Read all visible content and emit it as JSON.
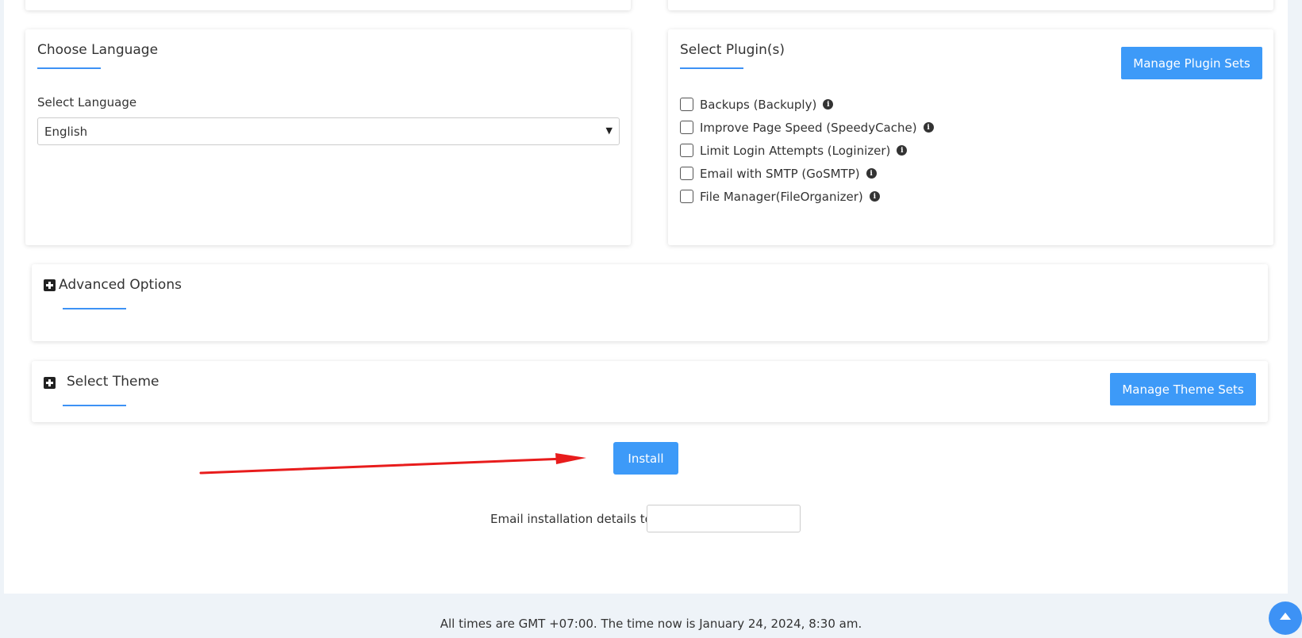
{
  "language_card": {
    "title": "Choose Language",
    "field_label": "Select Language",
    "selected_language": "English"
  },
  "plugins_card": {
    "title": "Select Plugin(s)",
    "manage_button": "Manage Plugin Sets",
    "plugins": [
      {
        "label": "Backups (Backuply)",
        "checked": false
      },
      {
        "label": "Improve Page Speed (SpeedyCache)",
        "checked": false
      },
      {
        "label": "Limit Login Attempts (Loginizer)",
        "checked": false
      },
      {
        "label": "Email with SMTP (GoSMTP)",
        "checked": false
      },
      {
        "label": "File Manager(FileOrganizer)",
        "checked": false
      }
    ]
  },
  "advanced": {
    "title": "Advanced Options"
  },
  "theme": {
    "title": "Select Theme",
    "manage_button": "Manage Theme Sets"
  },
  "install_button": "Install",
  "email": {
    "label": "Email installation details to :",
    "value": ""
  },
  "footer": {
    "text": "All times are GMT +07:00. The time now is January 24, 2024, 8:30 am."
  },
  "colors": {
    "accent": "#3d9af8",
    "annotation_arrow": "#e81c1c"
  },
  "icons": {
    "info": "info-circle-icon",
    "expand": "plus-square-icon",
    "scroll_top": "caret-up-icon"
  }
}
